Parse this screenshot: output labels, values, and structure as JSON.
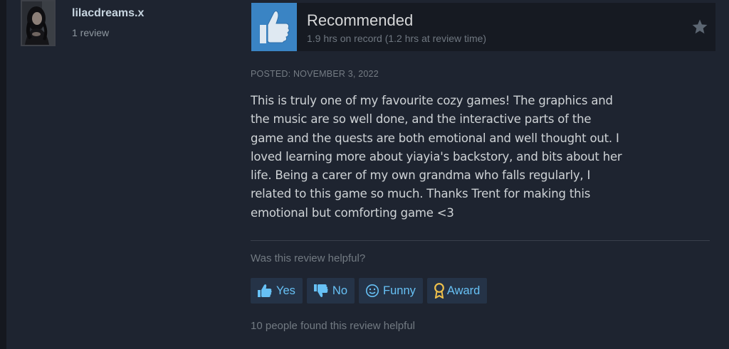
{
  "author": {
    "name": "lilacdreams.x",
    "review_count": "1 review",
    "avatar_icon": "profile-avatar"
  },
  "review": {
    "verdict": "Recommended",
    "verdict_icon": "thumbs-up-icon",
    "hours": "1.9 hrs on record (1.2 hrs at review time)",
    "posted": "POSTED: NOVEMBER 3, 2022",
    "text": "This is truly one of my favourite cozy games! The graphics and\nthe music are so well done, and the interactive parts of the\ngame and the quests are both emotional and well thought out. I\nloved learning more about yiayia's backstory, and bits about her\nlife. Being a carer of my own grandma who falls regularly, I\nrelated to this game so much. Thanks Trent for making this\nemotional but comforting game <3"
  },
  "helpful": {
    "question": "Was this review helpful?",
    "buttons": [
      {
        "label": "Yes",
        "icon": "thumbs-up-icon"
      },
      {
        "label": "No",
        "icon": "thumbs-down-icon"
      },
      {
        "label": "Funny",
        "icon": "smiley-icon"
      },
      {
        "label": "Award",
        "icon": "award-icon"
      }
    ],
    "summary": "10 people found this review helpful"
  },
  "colors": {
    "background": "#1e2430",
    "header_box": "#161a22",
    "thumb_box": "#3a84c4",
    "button_bg": "#253347",
    "button_text": "#67c1f5",
    "award_icon": "#f0c14b"
  }
}
